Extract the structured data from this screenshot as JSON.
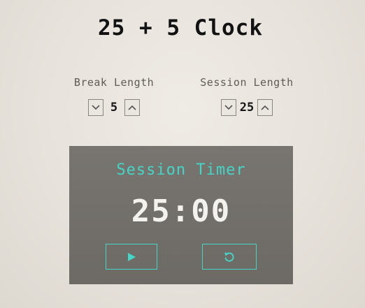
{
  "app": {
    "title": "25 + 5 Clock"
  },
  "break": {
    "label": "Break Length",
    "value": "5",
    "decrement_icon": "chevron-down-icon",
    "increment_icon": "chevron-up-icon"
  },
  "session": {
    "label": "Session Length",
    "value": "25",
    "decrement_icon": "chevron-down-icon",
    "increment_icon": "chevron-up-icon"
  },
  "timer": {
    "label": "Session Timer",
    "time": "25:00",
    "start_icon": "play-icon",
    "reset_icon": "reset-icon"
  },
  "colors": {
    "accent": "#43d6c6",
    "panel": "#736f6a",
    "background": "#e9e5df"
  }
}
